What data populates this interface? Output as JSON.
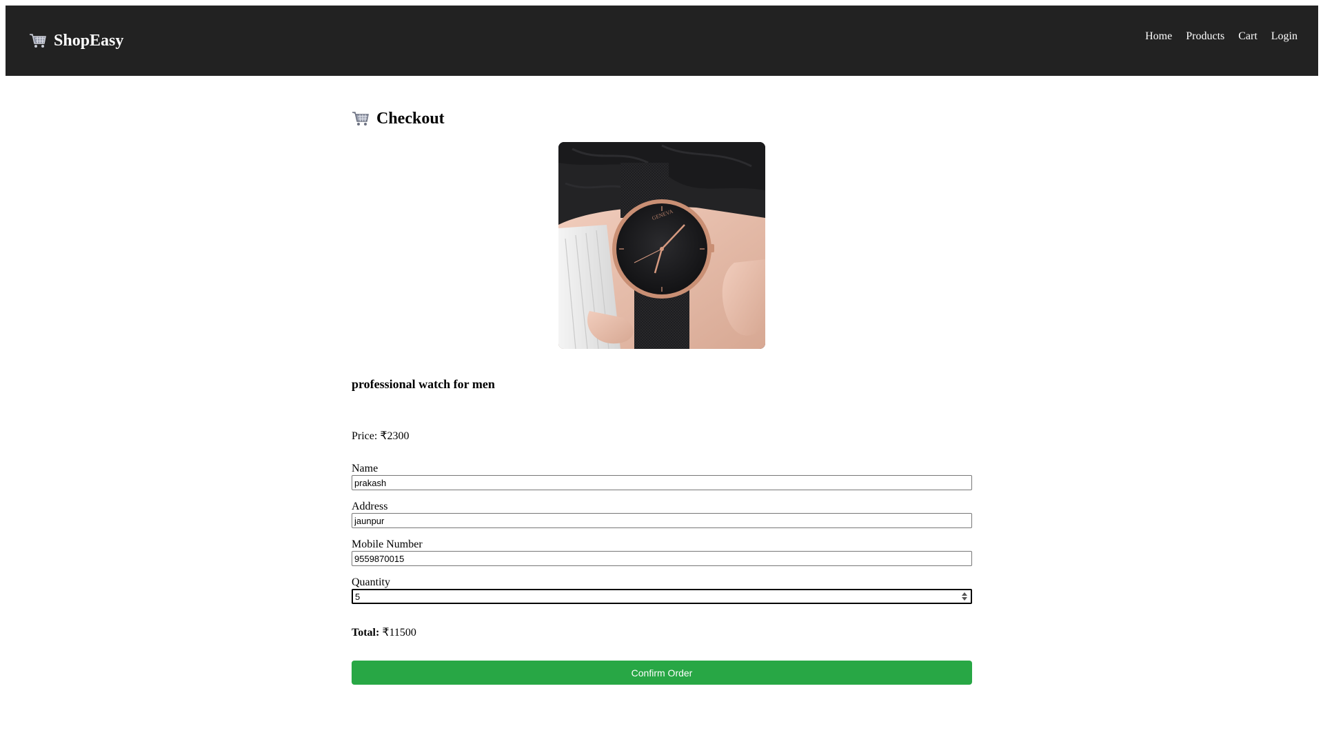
{
  "navbar": {
    "brand_icon": "shopping-cart-icon",
    "brand": "ShopEasy",
    "links": [
      "Home",
      "Products",
      "Cart",
      "Login"
    ]
  },
  "checkout": {
    "icon": "shopping-cart-icon",
    "title": "Checkout",
    "product_image": "wristwatch-photo",
    "product_name": "professional watch for men",
    "price_label": "Price:",
    "price_value": "₹2300",
    "fields": {
      "name": {
        "label": "Name",
        "value": "prakash"
      },
      "address": {
        "label": "Address",
        "value": "jaunpur"
      },
      "mobile": {
        "label": "Mobile Number",
        "value": "9559870015"
      },
      "quantity": {
        "label": "Quantity",
        "value": "5"
      }
    },
    "total_label": "Total:",
    "total_value": "₹11500",
    "confirm_label": "Confirm Order"
  },
  "colors": {
    "navbar_bg": "#222222",
    "confirm_bg": "#28a745",
    "text": "#000000"
  }
}
